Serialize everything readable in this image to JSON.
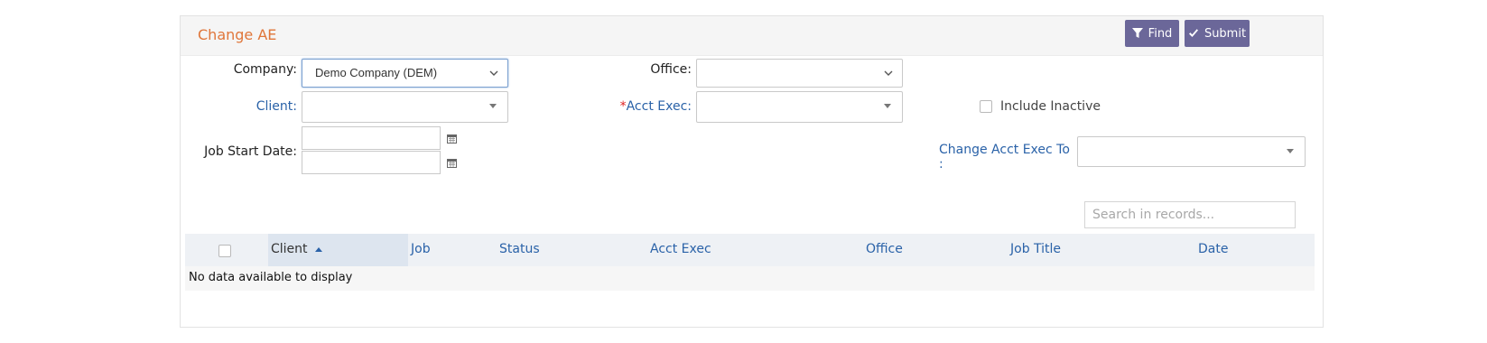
{
  "panel": {
    "title": "Change AE",
    "find_label": "Find",
    "submit_label": "Submit"
  },
  "form": {
    "company_label": "Company:",
    "company_value": "Demo Company (DEM)",
    "office_label": "Office:",
    "office_value": "",
    "client_label": "Client:",
    "client_value": "",
    "acct_exec_required_mark": "*",
    "acct_exec_label": "Acct Exec:",
    "acct_exec_value": "",
    "include_inactive_label": "Include Inactive",
    "job_start_date_label": "Job Start Date:",
    "change_acct_exec_label": "Change Acct Exec To :",
    "change_acct_exec_value": ""
  },
  "search": {
    "placeholder": "Search in records..."
  },
  "table": {
    "columns": [
      "Client",
      "Job",
      "Status",
      "Acct Exec",
      "Office",
      "Job Title",
      "Date"
    ],
    "sorted_column": "Client",
    "sort_direction": "ascending",
    "empty_text": "No data available to display"
  },
  "colors": {
    "title": "#e0763a",
    "button": "#6b6799",
    "link_blue": "#2a62a8",
    "required": "#dd2222"
  },
  "icons": {
    "find": "filter-icon",
    "submit": "check-icon",
    "date": "calendar-icon",
    "sort": "sort-ascending-icon"
  }
}
